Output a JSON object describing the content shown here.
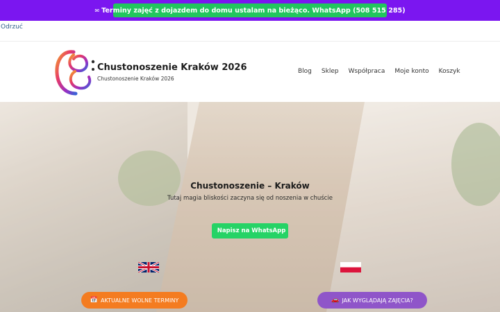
{
  "colors": {
    "notice_bar": "#7b16f0",
    "notice_pill": "#22c55e",
    "whatsapp_green": "#25d366",
    "terms_orange": "#f47c20",
    "how_purple": "#8f55c9"
  },
  "notice": {
    "icon": "mail-icon",
    "text": "Terminy zajęć z dojazdem do domu ustalam na bieżąco. WhatsApp (508 515 285)"
  },
  "dismiss": {
    "label": "Odrzuć"
  },
  "header": {
    "title": "Chustonoszenie Kraków 2026",
    "tagline": "Chustonoszenie Kraków 2026",
    "nav": [
      "Blog",
      "Sklep",
      "Współpraca",
      "Moje konto",
      "Koszyk"
    ]
  },
  "hero": {
    "title": "Chustonoszenie – Kraków",
    "subtitle": "Tutaj magia bliskości zaczyna się od noszenia w chuście ",
    "whatsapp_button": "Napisz na WhatsApp",
    "terms_button": "AKTUALNE WOLNE TERMINY",
    "how_button": "JAK WYGLĄDAJĄ ZAJĘCIA?",
    "flags": [
      "uk-flag-icon",
      "poland-flag-icon"
    ]
  }
}
